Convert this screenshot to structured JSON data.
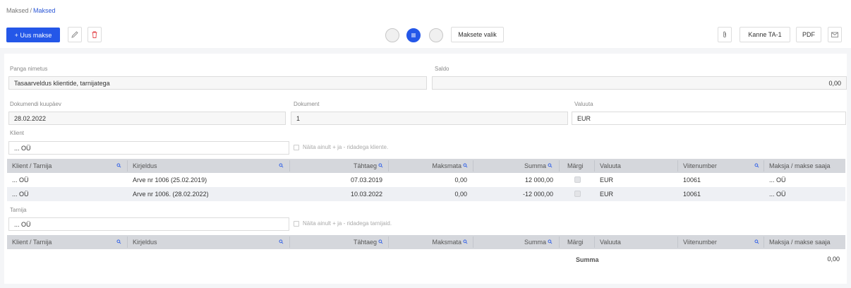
{
  "breadcrumb": {
    "parent": "Maksed",
    "separator": "/",
    "current": "Maksed"
  },
  "toolbar": {
    "new_payment": "+ Uus makse",
    "payment_select": "Maksete valik",
    "entry": "Kanne TA-1",
    "pdf": "PDF"
  },
  "form": {
    "bank_name_label": "Panga nimetus",
    "bank_name_value": "Tasaarveldus klientide, tarnijatega",
    "balance_label": "Saldo",
    "balance_value": "0,00",
    "doc_date_label": "Dokumendi kuupäev",
    "doc_date_value": "28.02.2022",
    "document_label": "Dokument",
    "document_value": "1",
    "currency_label": "Valuuta",
    "currency_value": "EUR",
    "client_label": "Klient",
    "client_value": "... OÜ",
    "client_filter": "Näita ainult + ja - ridadega kliente.",
    "supplier_label": "Tarnija",
    "supplier_value": "... OÜ",
    "supplier_filter": "Näita ainult + ja - ridadega tarnijaid."
  },
  "columns": {
    "client_supplier": "Klient / Tarnija",
    "description": "Kirjeldus",
    "due_date": "Tähtaeg",
    "unpaid": "Maksmata",
    "sum": "Summa",
    "mark": "Märgi",
    "currency": "Valuuta",
    "reference": "Viitenumber",
    "payer": "Maksja / makse saaja"
  },
  "client_rows": [
    {
      "party": "... OÜ",
      "description": "Arve nr 1006 (25.02.2019)",
      "due": "07.03.2019",
      "unpaid": "0,00",
      "sum": "12 000,00",
      "currency": "EUR",
      "reference": "10061",
      "payer": "... OÜ"
    },
    {
      "party": "... OÜ",
      "description": "Arve nr 1006. (28.02.2022)",
      "due": "10.03.2022",
      "unpaid": "0,00",
      "sum": "-12 000,00",
      "currency": "EUR",
      "reference": "10061",
      "payer": "... OÜ"
    }
  ],
  "totals": {
    "label": "Summa",
    "value": "0,00"
  },
  "icons": [
    "pencil-icon",
    "trash-icon",
    "menu-icon",
    "paperclip-icon",
    "envelope-icon",
    "search-icon"
  ],
  "colors": {
    "accent": "#2457e8",
    "danger": "#e5484d",
    "header_bg": "#d5d7dc"
  }
}
